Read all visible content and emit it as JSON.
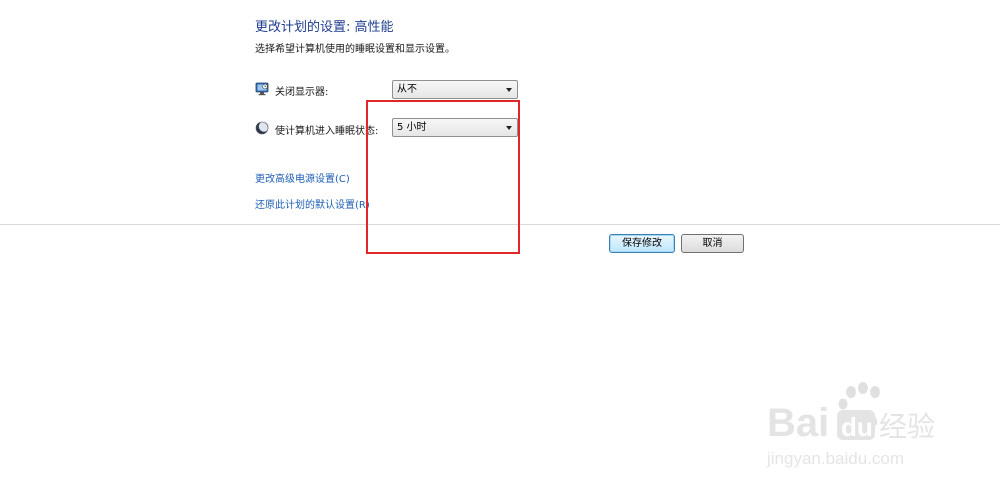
{
  "header": {
    "title": "更改计划的设置: 高性能",
    "subtitle": "选择希望计算机使用的睡眠设置和显示设置。"
  },
  "settings": [
    {
      "label": "关闭显示器:",
      "icon": "monitor-icon",
      "value": "从不"
    },
    {
      "label": "使计算机进入睡眠状态:",
      "icon": "moon-icon",
      "value": "5 小时"
    }
  ],
  "links": {
    "advanced": "更改高级电源设置(C)",
    "restore": "还原此计划的默认设置(R)"
  },
  "buttons": {
    "save": "保存修改",
    "cancel": "取消"
  },
  "watermark": {
    "brand": "Baidu经验",
    "url": "jingyan.baidu.com"
  },
  "colors": {
    "title": "#1e3d8f",
    "link": "#1f5fb5",
    "highlight": "#e0262b"
  }
}
